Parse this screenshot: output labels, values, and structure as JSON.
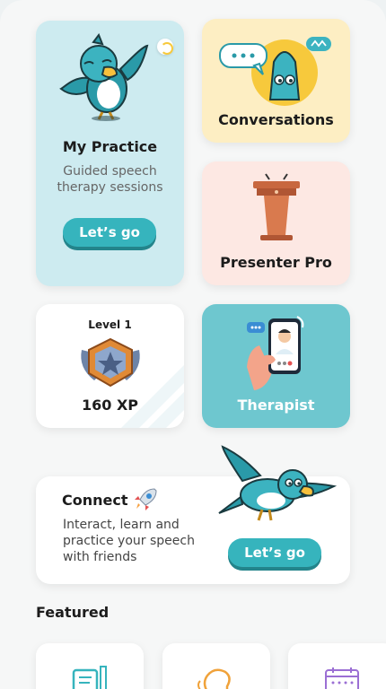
{
  "practice": {
    "title": "My Practice",
    "subtitle_line1": "Guided speech",
    "subtitle_line2": "therapy sessions",
    "button": "Let’s go"
  },
  "conversations": {
    "title": "Conversations"
  },
  "presenter": {
    "title": "Presenter Pro"
  },
  "level": {
    "label": "Level 1",
    "xp": "160 XP"
  },
  "therapist": {
    "title": "Therapist"
  },
  "connect": {
    "title": "Connect",
    "desc_line1": "Interact, learn and",
    "desc_line2": "practice your speech",
    "desc_line3": "with friends",
    "button": "Let’s go"
  },
  "featured": {
    "title": "Featured"
  },
  "colors": {
    "teal": "#36b4bd",
    "practice_bg": "#cdebf0",
    "convo_bg": "#fdeec3",
    "presenter_bg": "#fde8e3",
    "therapist_bg": "#6ec7cf"
  }
}
